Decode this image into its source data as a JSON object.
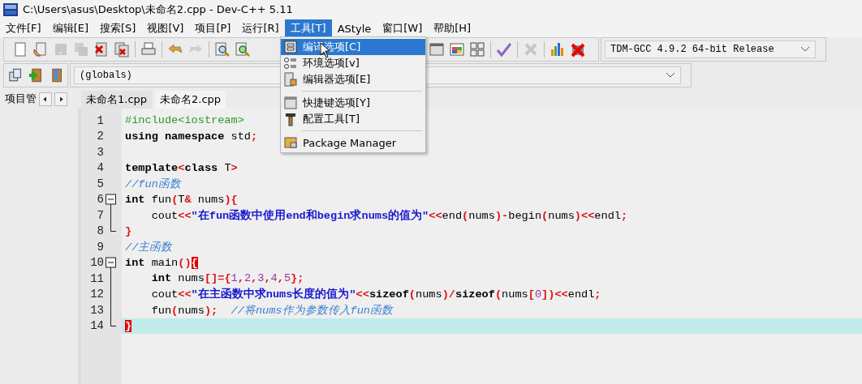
{
  "window": {
    "title": "C:\\Users\\asus\\Desktop\\未命名2.cpp - Dev-C++ 5.11"
  },
  "menubar": [
    {
      "label": "文件[F]",
      "selected": false
    },
    {
      "label": "编辑[E]",
      "selected": false
    },
    {
      "label": "搜索[S]",
      "selected": false
    },
    {
      "label": "视图[V]",
      "selected": false
    },
    {
      "label": "项目[P]",
      "selected": false
    },
    {
      "label": "运行[R]",
      "selected": false
    },
    {
      "label": "工具[T]",
      "selected": true
    },
    {
      "label": "AStyle",
      "selected": false
    },
    {
      "label": "窗口[W]",
      "selected": false
    },
    {
      "label": "帮助[H]",
      "selected": false
    }
  ],
  "toolbar": {
    "groups": [
      [
        {
          "disabled": false
        },
        {
          "disabled": false
        },
        {
          "disabled": true
        },
        {
          "disabled": true
        },
        {
          "disabled": false
        },
        {
          "disabled": false
        }
      ],
      [
        {
          "disabled": false
        }
      ],
      [
        {
          "disabled": false
        },
        {
          "disabled": true
        }
      ],
      [
        {
          "disabled": false
        },
        {
          "disabled": false
        }
      ],
      [
        {
          "disabled": false
        },
        {
          "disabled": false
        },
        {
          "disabled": false
        }
      ],
      [
        {
          "disabled": false
        }
      ],
      [
        {
          "disabled": true
        }
      ],
      [
        {
          "disabled": false
        },
        {
          "disabled": false
        }
      ]
    ],
    "compiler": "TDM-GCC 4.9.2 64-bit Release"
  },
  "toolbar2": {
    "scope": "(globals)"
  },
  "project_pane": {
    "title": "项目管"
  },
  "tabs": [
    {
      "label": "未命名1.cpp",
      "selected": false
    },
    {
      "label": "未命名2.cpp",
      "selected": true
    }
  ],
  "menu": [
    {
      "kind": "item",
      "label": "编译选项[C]",
      "selected": true
    },
    {
      "kind": "item",
      "label": "环境选项[v]",
      "selected": false
    },
    {
      "kind": "item",
      "label": "编辑器选项[E]",
      "selected": false
    },
    {
      "kind": "separator"
    },
    {
      "kind": "item",
      "label": "快捷键选项[Y]",
      "selected": false
    },
    {
      "kind": "item",
      "label": "配置工具[T]",
      "selected": false
    },
    {
      "kind": "separator"
    },
    {
      "kind": "item",
      "label": "Package Manager",
      "selected": false
    }
  ],
  "editor": {
    "lines": [
      {
        "number": "1",
        "current": false,
        "tokens": [
          {
            "kind": "pre",
            "text": "#include<iostream>"
          }
        ]
      },
      {
        "number": "2",
        "current": false,
        "tokens": [
          {
            "kind": "kw",
            "text": "using namespace"
          },
          {
            "kind": "id",
            "text": " std"
          },
          {
            "kind": "sym",
            "text": ";"
          }
        ]
      },
      {
        "number": "3",
        "current": false
      },
      {
        "number": "4",
        "current": false,
        "tokens": [
          {
            "kind": "kw",
            "text": "template"
          },
          {
            "kind": "sym",
            "text": "<"
          },
          {
            "kind": "kw",
            "text": "class"
          },
          {
            "kind": "id",
            "text": " T"
          },
          {
            "kind": "sym",
            "text": ">"
          }
        ]
      },
      {
        "number": "5",
        "current": false,
        "tokens": [
          {
            "kind": "cmt",
            "text": "//fun函数"
          }
        ]
      },
      {
        "number": "6",
        "current": false,
        "fold": {
          "kind": "start"
        },
        "tokens": [
          {
            "kind": "kw",
            "text": "int"
          },
          {
            "kind": "id",
            "text": " fun"
          },
          {
            "kind": "sym",
            "text": "("
          },
          {
            "kind": "id",
            "text": "T"
          },
          {
            "kind": "sym",
            "text": "&"
          },
          {
            "kind": "id",
            "text": " nums"
          },
          {
            "kind": "sym",
            "text": ")"
          },
          {
            "kind": "sym",
            "text": "{"
          }
        ]
      },
      {
        "number": "7",
        "current": false,
        "fold": {
          "kind": "line"
        },
        "tokens": [
          {
            "kind": "id",
            "text": "    cout"
          },
          {
            "kind": "sym",
            "text": "<<"
          },
          {
            "kind": "str",
            "text": "\"在fun函数中使用end和begin求nums的值为\""
          },
          {
            "kind": "sym",
            "text": "<<"
          },
          {
            "kind": "id",
            "text": "end"
          },
          {
            "kind": "sym",
            "text": "("
          },
          {
            "kind": "id",
            "text": "nums"
          },
          {
            "kind": "sym",
            "text": ")"
          },
          {
            "kind": "sym",
            "text": "-"
          },
          {
            "kind": "id",
            "text": "begin"
          },
          {
            "kind": "sym",
            "text": "("
          },
          {
            "kind": "id",
            "text": "nums"
          },
          {
            "kind": "sym",
            "text": ")"
          },
          {
            "kind": "sym",
            "text": "<<"
          },
          {
            "kind": "id",
            "text": "endl"
          },
          {
            "kind": "sym",
            "text": ";"
          }
        ]
      },
      {
        "number": "8",
        "current": false,
        "fold": {
          "kind": "end"
        },
        "tokens": [
          {
            "kind": "sym",
            "text": "}"
          }
        ]
      },
      {
        "number": "9",
        "current": false,
        "tokens": [
          {
            "kind": "cmt",
            "text": "//主函数"
          }
        ]
      },
      {
        "number": "10",
        "current": false,
        "fold": {
          "kind": "start"
        },
        "tokens": [
          {
            "kind": "kw",
            "text": "int"
          },
          {
            "kind": "id",
            "text": " main"
          },
          {
            "kind": "sym",
            "text": "()"
          },
          {
            "kind": "match",
            "text": "{"
          }
        ]
      },
      {
        "number": "11",
        "current": false,
        "fold": {
          "kind": "line"
        },
        "tokens": [
          {
            "kind": "kw",
            "text": "    int"
          },
          {
            "kind": "id",
            "text": " nums"
          },
          {
            "kind": "sym",
            "text": "[]={"
          },
          {
            "kind": "num",
            "text": "1"
          },
          {
            "kind": "sym",
            "text": ","
          },
          {
            "kind": "num",
            "text": "2"
          },
          {
            "kind": "sym",
            "text": ","
          },
          {
            "kind": "num",
            "text": "3"
          },
          {
            "kind": "sym",
            "text": ","
          },
          {
            "kind": "num",
            "text": "4"
          },
          {
            "kind": "sym",
            "text": ","
          },
          {
            "kind": "num",
            "text": "5"
          },
          {
            "kind": "sym",
            "text": "};"
          }
        ]
      },
      {
        "number": "12",
        "current": false,
        "fold": {
          "kind": "line"
        },
        "tokens": [
          {
            "kind": "id",
            "text": "    cout"
          },
          {
            "kind": "sym",
            "text": "<<"
          },
          {
            "kind": "str",
            "text": "\"在主函数中求nums长度的值为\""
          },
          {
            "kind": "sym",
            "text": "<<"
          },
          {
            "kind": "kw",
            "text": "sizeof"
          },
          {
            "kind": "sym",
            "text": "("
          },
          {
            "kind": "id",
            "text": "nums"
          },
          {
            "kind": "sym",
            "text": ")/"
          },
          {
            "kind": "kw",
            "text": "sizeof"
          },
          {
            "kind": "sym",
            "text": "("
          },
          {
            "kind": "id",
            "text": "nums"
          },
          {
            "kind": "sym",
            "text": "["
          },
          {
            "kind": "num",
            "text": "0"
          },
          {
            "kind": "sym",
            "text": "])<<"
          },
          {
            "kind": "id",
            "text": "endl"
          },
          {
            "kind": "sym",
            "text": ";"
          }
        ]
      },
      {
        "number": "13",
        "current": false,
        "fold": {
          "kind": "line"
        },
        "tokens": [
          {
            "kind": "id",
            "text": "    fun"
          },
          {
            "kind": "sym",
            "text": "("
          },
          {
            "kind": "id",
            "text": "nums"
          },
          {
            "kind": "sym",
            "text": ");"
          },
          {
            "kind": "cmt",
            "text": "  //将nums作为参数传入fun函数"
          }
        ]
      },
      {
        "number": "14",
        "current": true,
        "fold": {
          "kind": "end"
        },
        "tokens": [
          {
            "kind": "match",
            "text": "}"
          }
        ]
      }
    ]
  }
}
